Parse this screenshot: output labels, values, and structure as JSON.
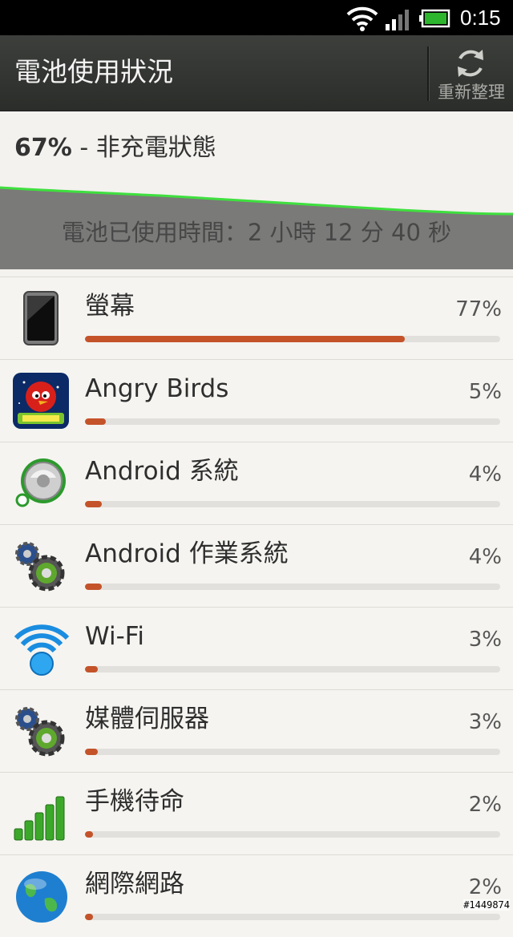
{
  "status_bar": {
    "time": "0:15",
    "icons": [
      "wifi-icon",
      "signal-icon",
      "battery-charging-icon"
    ],
    "battery_color": "#2db52d"
  },
  "action_bar": {
    "title": "電池使用狀況",
    "refresh_label": "重新整理",
    "refresh_icon": "refresh-icon"
  },
  "summary": {
    "percent": "67%",
    "status": " - 非充電狀態",
    "usage_time": "電池已使用時間：2 小時 12 分 40 秒"
  },
  "usage_items": [
    {
      "name": "螢幕",
      "percent": "77%",
      "value": 0.77,
      "icon": "phone-screen-icon"
    },
    {
      "name": "Angry Birds",
      "percent": "5%",
      "value": 0.05,
      "icon": "angry-birds-icon"
    },
    {
      "name": "Android 系統",
      "percent": "4%",
      "value": 0.04,
      "icon": "android-system-icon"
    },
    {
      "name": "Android 作業系統",
      "percent": "4%",
      "value": 0.04,
      "icon": "gears-icon"
    },
    {
      "name": "Wi-Fi",
      "percent": "3%",
      "value": 0.03,
      "icon": "wifi-icon"
    },
    {
      "name": "媒體伺服器",
      "percent": "3%",
      "value": 0.03,
      "icon": "gears-icon"
    },
    {
      "name": "手機待命",
      "percent": "2%",
      "value": 0.02,
      "icon": "signal-bars-icon"
    },
    {
      "name": "網際網路",
      "percent": "2%",
      "value": 0.02,
      "icon": "globe-icon"
    }
  ],
  "colors": {
    "bar_fill": "#c4532a",
    "graph_line": "#3ee03e",
    "graph_fill": "#7a7a78"
  },
  "watermark": "#1449874"
}
